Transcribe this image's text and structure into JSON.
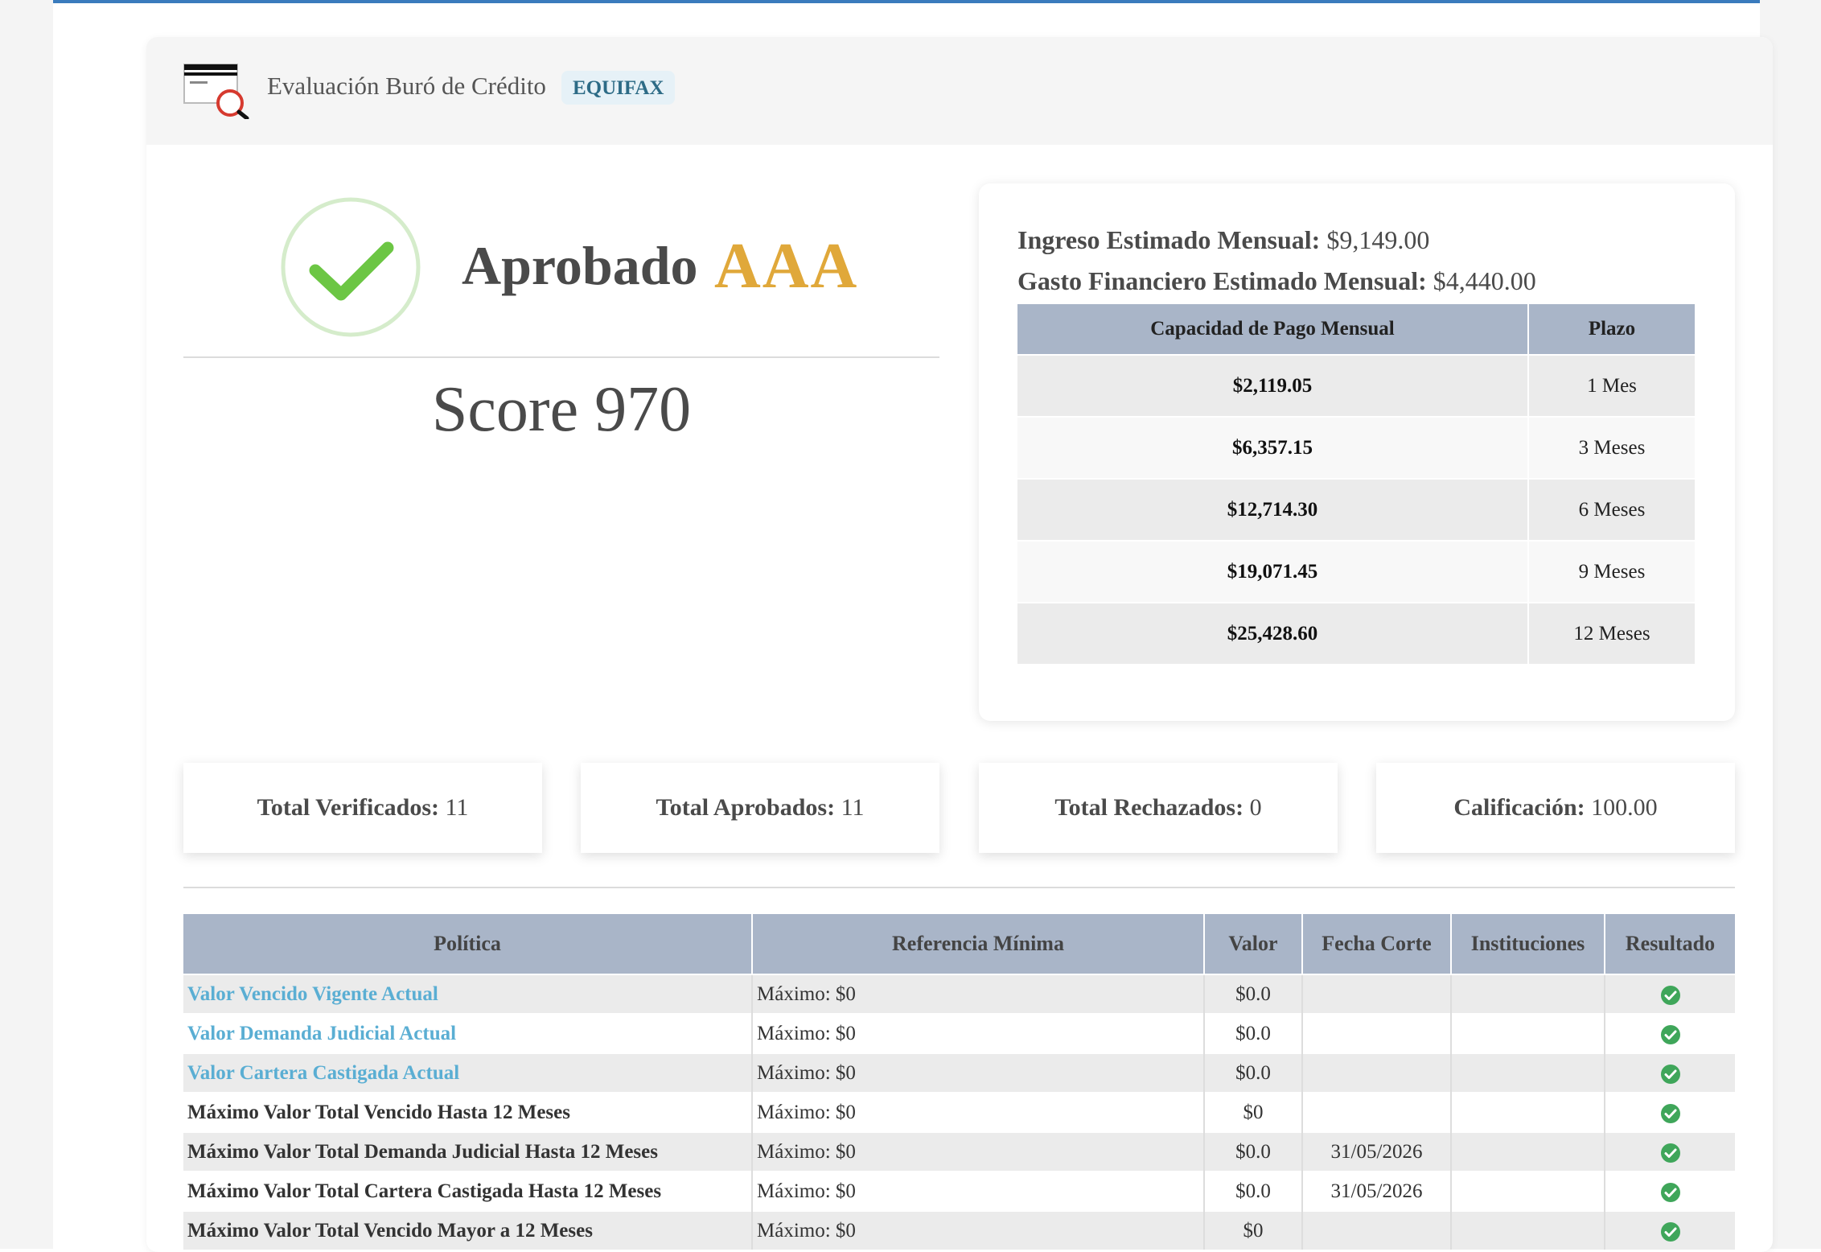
{
  "header": {
    "title": "Evaluación Buró de Crédito",
    "badge": "EQUIFAX"
  },
  "result": {
    "status": "Aprobado",
    "grade": "AAA",
    "score": "Score 970"
  },
  "income": {
    "ingreso_label": "Ingreso Estimado Mensual:",
    "ingreso_value": "$9,149.00",
    "gasto_label": "Gasto Financiero Estimado Mensual:",
    "gasto_value": "$4,440.00",
    "columns": [
      "Capacidad de Pago Mensual",
      "Plazo"
    ],
    "rows": [
      {
        "amount": "$2,119.05",
        "term": "1 Mes"
      },
      {
        "amount": "$6,357.15",
        "term": "3 Meses"
      },
      {
        "amount": "$12,714.30",
        "term": "6 Meses"
      },
      {
        "amount": "$19,071.45",
        "term": "9 Meses"
      },
      {
        "amount": "$25,428.60",
        "term": "12 Meses"
      }
    ]
  },
  "stats": [
    {
      "label": "Total Verificados:",
      "value": "11"
    },
    {
      "label": "Total Aprobados:",
      "value": "11"
    },
    {
      "label": "Total Rechazados:",
      "value": "0"
    },
    {
      "label": "Calificación:",
      "value": "100.00"
    }
  ],
  "policy_table": {
    "columns": [
      "Política",
      "Referencia Mínima",
      "Valor",
      "Fecha Corte",
      "Instituciones",
      "Resultado"
    ],
    "rows": [
      {
        "policy": "Valor Vencido Vigente Actual",
        "link": true,
        "ref": "Máximo: $0",
        "value": "$0.0",
        "fecha": "",
        "inst": "",
        "result": "ok"
      },
      {
        "policy": "Valor Demanda Judicial Actual",
        "link": true,
        "ref": "Máximo: $0",
        "value": "$0.0",
        "fecha": "",
        "inst": "",
        "result": "ok"
      },
      {
        "policy": "Valor Cartera Castigada Actual",
        "link": true,
        "ref": "Máximo: $0",
        "value": "$0.0",
        "fecha": "",
        "inst": "",
        "result": "ok"
      },
      {
        "policy": "Máximo Valor Total Vencido Hasta 12 Meses",
        "link": false,
        "ref": "Máximo: $0",
        "value": "$0",
        "fecha": "",
        "inst": "",
        "result": "ok"
      },
      {
        "policy": "Máximo Valor Total Demanda Judicial Hasta 12 Meses",
        "link": false,
        "ref": "Máximo: $0",
        "value": "$0.0",
        "fecha": "31/05/2026",
        "inst": "",
        "result": "ok"
      },
      {
        "policy": "Máximo Valor Total Cartera Castigada Hasta 12 Meses",
        "link": false,
        "ref": "Máximo: $0",
        "value": "$0.0",
        "fecha": "31/05/2026",
        "inst": "",
        "result": "ok"
      },
      {
        "policy": "Máximo Valor Total Vencido Mayor a 12 Meses",
        "link": false,
        "ref": "Máximo: $0",
        "value": "$0",
        "fecha": "",
        "inst": "",
        "result": "ok"
      }
    ]
  },
  "colors": {
    "accent_grade": "#e0a83a",
    "table_header": "#a9b5c8",
    "link": "#5aaed3",
    "ok_green": "#3fa65a",
    "check_green": "#6cc644"
  },
  "icons": {
    "header_icon": "credit-card-search-icon",
    "status_icon": "check-circle-icon",
    "result_icon": "check-circle-filled-icon"
  }
}
